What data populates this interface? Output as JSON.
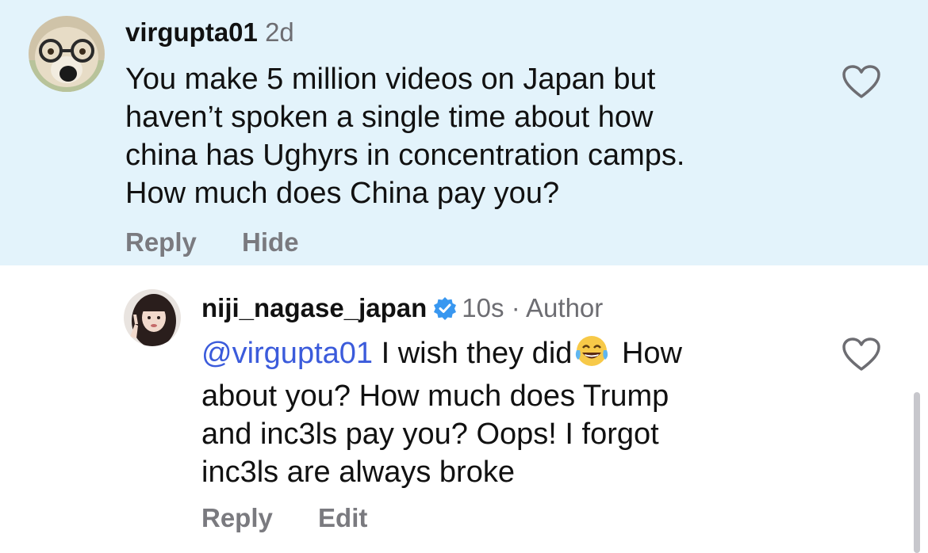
{
  "comments": [
    {
      "username": "virgupta01",
      "time": "2d",
      "lines": [
        "You make 5 million videos on Japan but",
        "haven’t spoken a single time about how",
        "china has Ughyrs in concentration camps.",
        "How much does China pay you?"
      ],
      "actions": [
        "Reply",
        "Hide"
      ],
      "avatar_icon": "dog-with-glasses-avatar",
      "like_icon": "heart-outline-icon"
    },
    {
      "username": "niji_nagase_japan",
      "verified_icon": "verified-badge-icon",
      "time": "10s",
      "separator": "·",
      "author_label": "Author",
      "mention": "@virgupta01",
      "line1_text": " I wish they did",
      "emoji_icon": "laughing-tears-emoji",
      "line1_tail": " How",
      "lines": [
        "about you? How much does Trump",
        "and inc3ls pay you? Oops! I forgot",
        "inc3ls are always broke"
      ],
      "actions": [
        "Reply",
        "Edit"
      ],
      "avatar_icon": "woman-portrait-avatar",
      "like_icon": "heart-outline-icon"
    }
  ],
  "colors": {
    "highlight_bg": "#e3f3fb",
    "mention": "#3b5bdb",
    "verified": "#3897f0",
    "secondary_text": "#6d6d72"
  }
}
